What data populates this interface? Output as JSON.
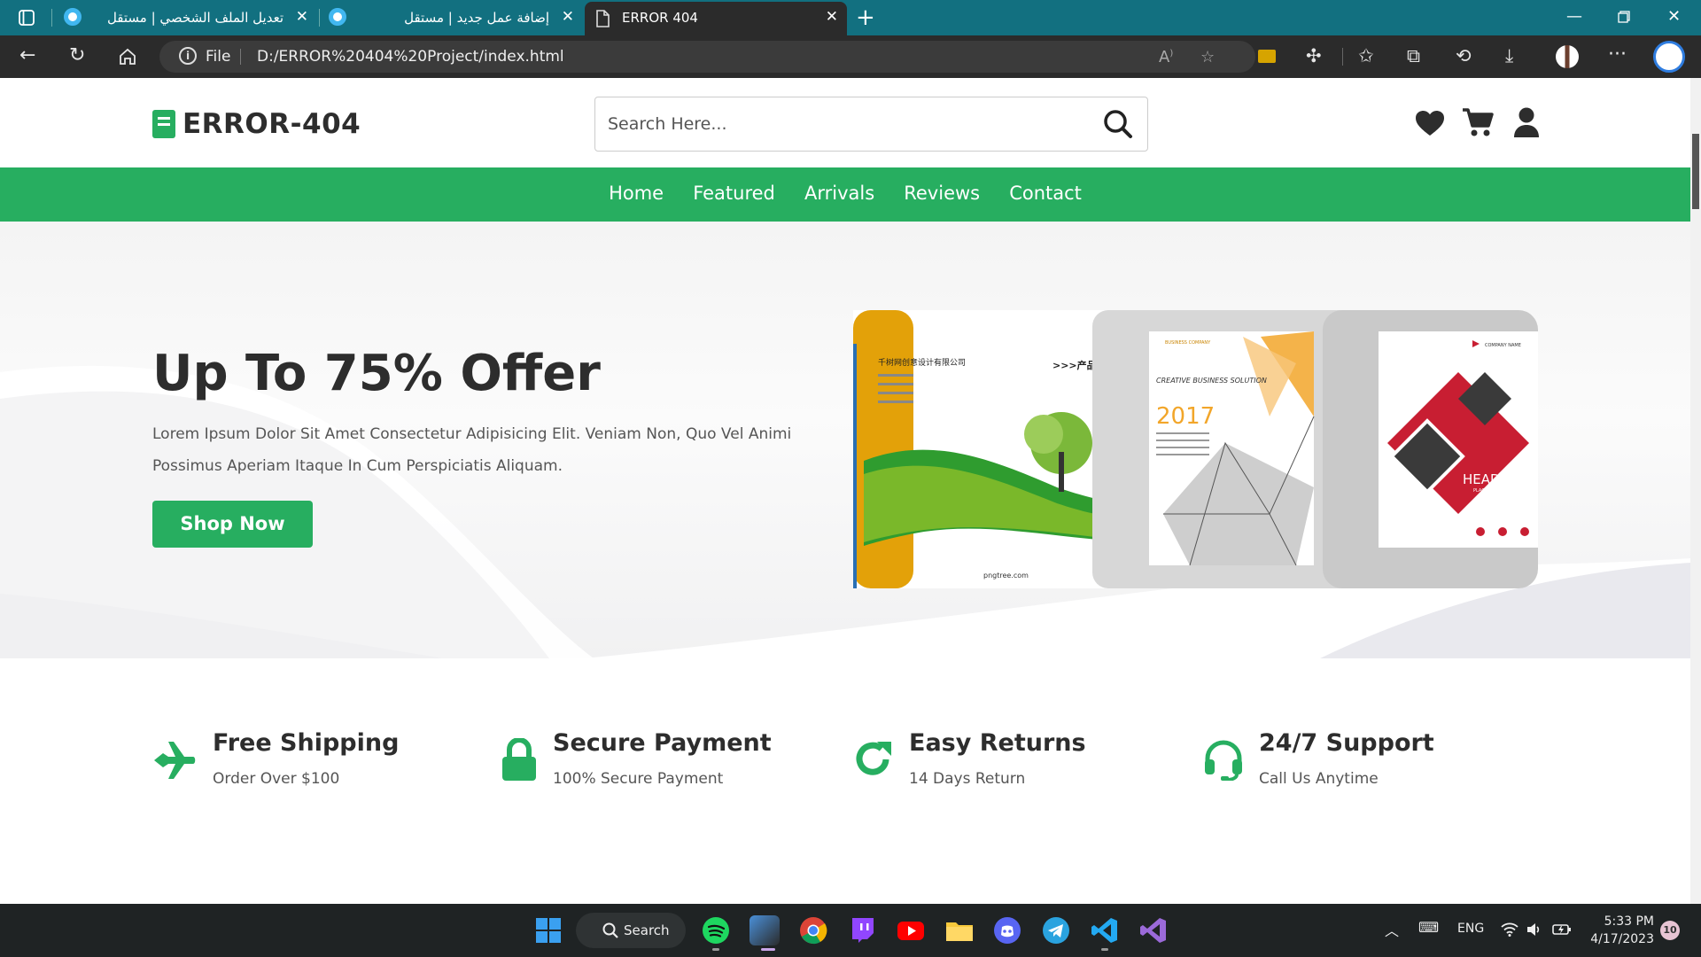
{
  "browser": {
    "tabs": [
      {
        "label": "تعديل الملف الشخصي | مستقل"
      },
      {
        "label": "إضافة عمل جديد | مستقل"
      },
      {
        "label": "ERROR 404"
      }
    ],
    "url_scheme": "File",
    "url": "D:/ERROR%20404%20Project/index.html"
  },
  "site": {
    "logo": "ERROR-404",
    "search_placeholder": "Search Here...",
    "nav": [
      "Home",
      "Featured",
      "Arrivals",
      "Reviews",
      "Contact"
    ],
    "hero": {
      "title": "Up To 75% Offer",
      "description": "Lorem Ipsum Dolor Sit Amet Consectetur Adipisicing Elit. Veniam Non, Quo Vel Animi Possimus Aperiam Itaque In Cum Perspiciatis Aliquam.",
      "button": "Shop Now"
    },
    "books": {
      "book1_company": "千树网创意设计有限公司",
      "book1_heading": ">>>产品",
      "book1_footer": "pngtree.com",
      "book2_brand": "BUSINESS COMPANY",
      "book2_title": "CREATIVE BUSINESS SOLUTION",
      "book2_year": "2017",
      "book3_company": "COMPANY NAME",
      "book3_headline": "HEADLINE",
      "book3_sub": "PLACE YOUR TEXT HERE"
    },
    "features": [
      {
        "title": "Free Shipping",
        "subtitle": "Order Over $100",
        "icon": "plane-icon"
      },
      {
        "title": "Secure Payment",
        "subtitle": "100% Secure Payment",
        "icon": "lock-icon"
      },
      {
        "title": "Easy Returns",
        "subtitle": "14 Days Return",
        "icon": "redo-icon"
      },
      {
        "title": "24/7 Support",
        "subtitle": "Call Us Anytime",
        "icon": "headset-icon"
      }
    ],
    "accent_color": "#27ae60"
  },
  "taskbar": {
    "search_label": "Search",
    "language": "ENG",
    "time": "5:33 PM",
    "date": "4/17/2023",
    "notifications": "10"
  }
}
